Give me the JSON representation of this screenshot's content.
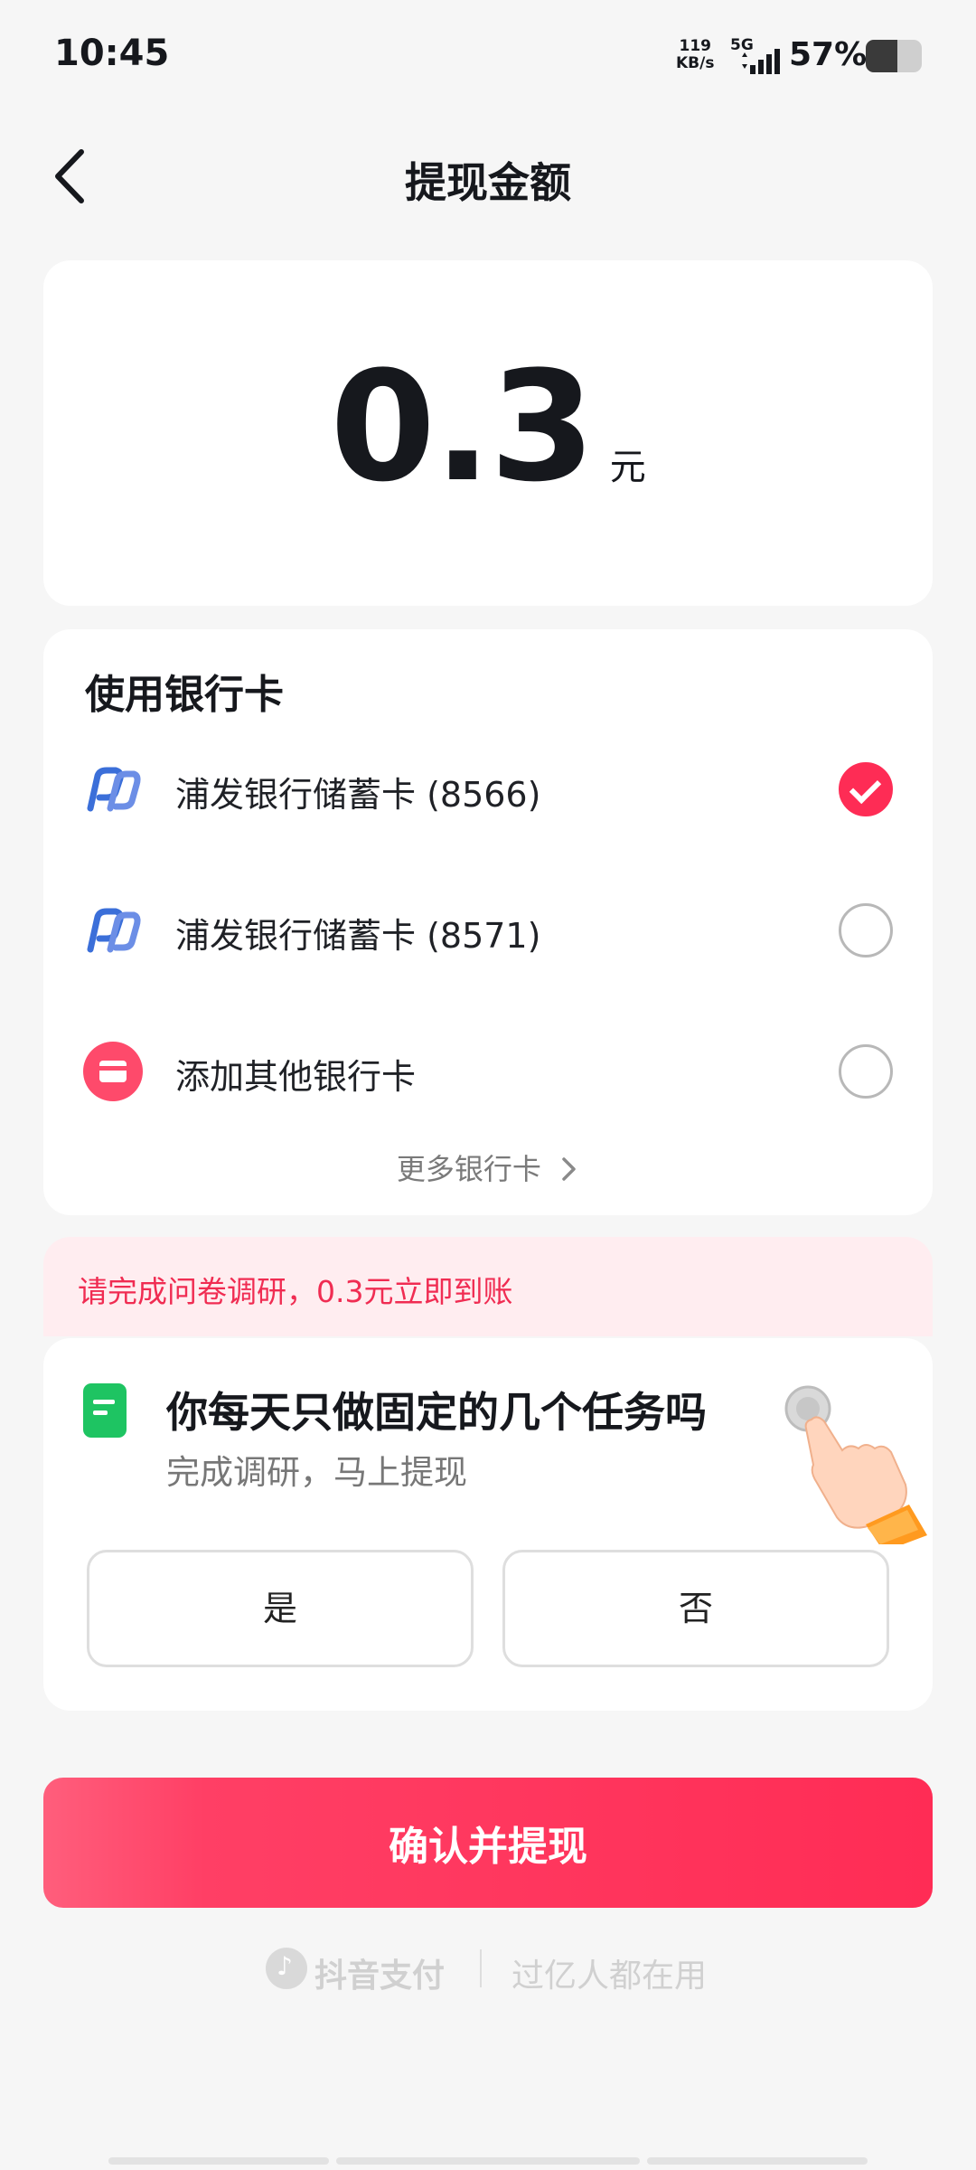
{
  "status_bar": {
    "time": "10:45",
    "net_speed_value": "119",
    "net_speed_unit": "KB/s",
    "network_type": "5G",
    "battery_percent": "57%",
    "battery_level": 0.57
  },
  "nav": {
    "title": "提现金额",
    "back_icon": "chevron-left-icon"
  },
  "amount": {
    "value": "0.3",
    "unit": "元"
  },
  "bank_section": {
    "title": "使用银行卡",
    "cards": [
      {
        "label": "浦发银行储蓄卡 (8566)",
        "icon": "spdb-bank-icon",
        "selected": true
      },
      {
        "label": "浦发银行储蓄卡 (8571)",
        "icon": "spdb-bank-icon",
        "selected": false
      },
      {
        "label": "添加其他银行卡",
        "icon": "add-card-icon",
        "selected": false
      }
    ],
    "more_label": "更多银行卡"
  },
  "survey": {
    "banner": "请完成问卷调研，0.3元立即到账",
    "question": "你每天只做固定的几个任务吗",
    "subtitle": "完成调研，马上提现",
    "yes_label": "是",
    "no_label": "否"
  },
  "confirm_label": "确认并提现",
  "footer": {
    "brand": "抖音支付",
    "slogan": "过亿人都在用"
  },
  "colors": {
    "accent": "#fe2c55",
    "banner_bg": "#ffedf0",
    "survey_icon": "#1ec462",
    "bank_icon": "#3b6fd9"
  }
}
